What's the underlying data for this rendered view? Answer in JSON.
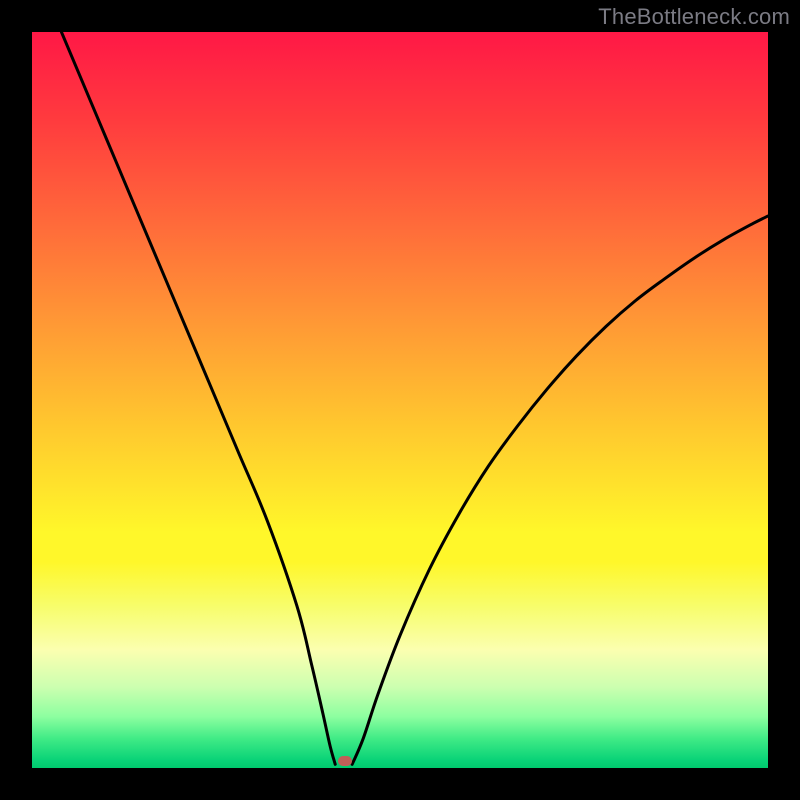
{
  "watermark": "TheBottleneck.com",
  "chart_data": {
    "type": "line",
    "title": "",
    "xlabel": "",
    "ylabel": "",
    "xlim": [
      0,
      100
    ],
    "ylim": [
      0,
      100
    ],
    "grid": false,
    "legend": false,
    "series": [
      {
        "name": "curve-left",
        "x": [
          4,
          8,
          12,
          16,
          20,
          24,
          28,
          32,
          36,
          38,
          39.5,
          40.5,
          41.2
        ],
        "y": [
          100,
          90.5,
          81,
          71.5,
          62,
          52.5,
          43,
          33.5,
          22,
          14,
          7.5,
          3,
          0.5
        ]
      },
      {
        "name": "curve-right",
        "x": [
          43.5,
          45,
          47,
          50,
          54,
          58,
          62,
          66,
          70,
          74,
          78,
          82,
          86,
          90,
          94,
          98,
          100
        ],
        "y": [
          0.5,
          4,
          10,
          18,
          27,
          34.5,
          41,
          46.5,
          51.5,
          56,
          60,
          63.5,
          66.5,
          69.3,
          71.8,
          74,
          75
        ]
      }
    ],
    "marker": {
      "x": 42.5,
      "y": 1.0
    },
    "background_gradient_stops": [
      {
        "pos": 0,
        "color": "#ff1846"
      },
      {
        "pos": 12,
        "color": "#ff3b3e"
      },
      {
        "pos": 26,
        "color": "#ff6a3a"
      },
      {
        "pos": 40,
        "color": "#ff9a35"
      },
      {
        "pos": 54,
        "color": "#ffc92e"
      },
      {
        "pos": 68,
        "color": "#fff72a"
      },
      {
        "pos": 78,
        "color": "#f7fd6b"
      },
      {
        "pos": 84,
        "color": "#fbffb0"
      },
      {
        "pos": 89,
        "color": "#ccffb0"
      },
      {
        "pos": 93,
        "color": "#8dffa0"
      },
      {
        "pos": 96,
        "color": "#40eb86"
      },
      {
        "pos": 100,
        "color": "#00c96e"
      }
    ]
  }
}
